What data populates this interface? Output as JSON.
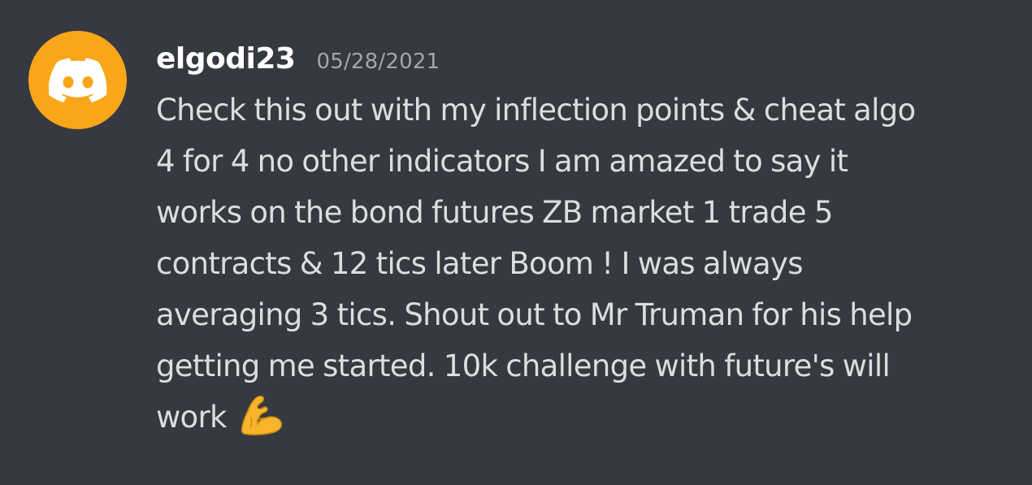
{
  "message": {
    "username": "elgodi23",
    "timestamp": "05/28/2021",
    "avatar_icon": "discord-logo-icon",
    "avatar_color": "#faa61a",
    "content_lines": [
      "Check this out with my inflection points & cheat algo",
      "4 for 4 no other indicators I am amazed to say it",
      "works on the bond futures ZB market 1 trade 5",
      "contracts & 12 tics later Boom ! I was always",
      "averaging 3 tics. Shout out to Mr Truman for his help",
      "getting me started. 10k challenge with future's will",
      "work"
    ],
    "trailing_emoji": "flexed-biceps-icon"
  },
  "theme": {
    "background": "#36393f",
    "username_color": "#ffffff",
    "timestamp_color": "#a3a6aa",
    "text_color": "#dcddde"
  }
}
